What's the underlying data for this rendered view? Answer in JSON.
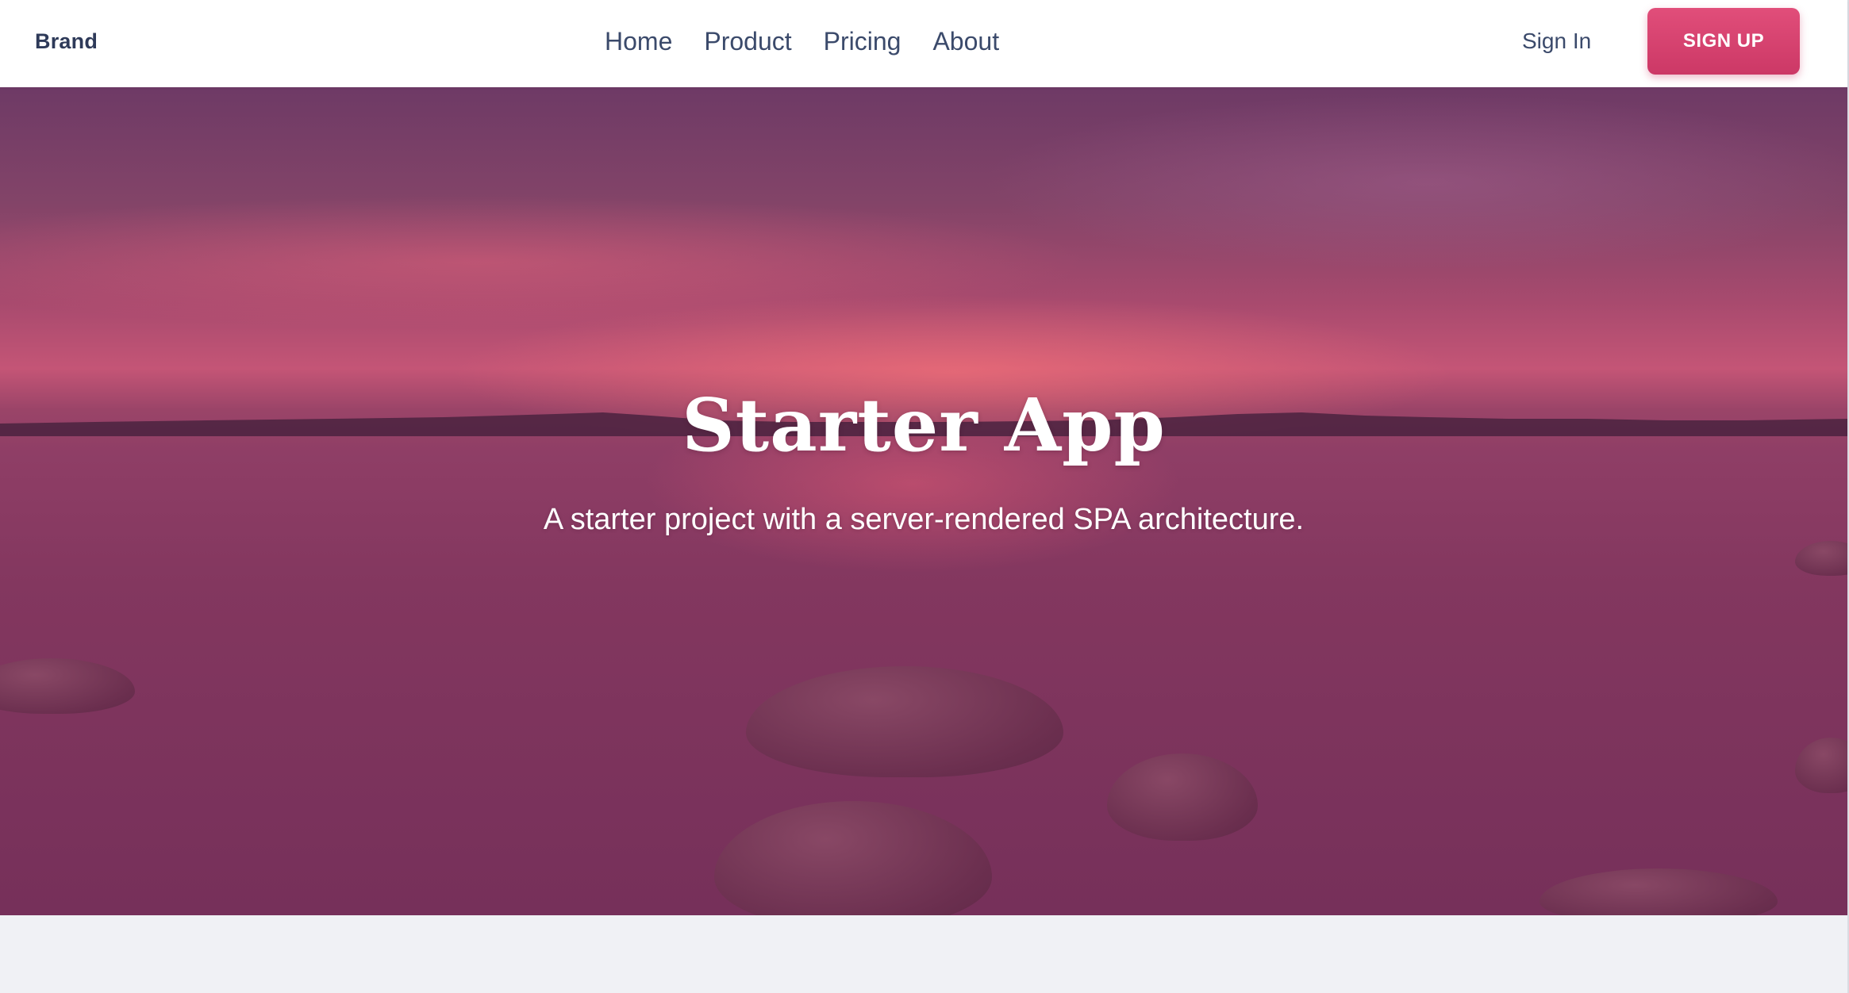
{
  "header": {
    "brand": "Brand",
    "nav": [
      "Home",
      "Product",
      "Pricing",
      "About"
    ],
    "sign_in": "Sign In",
    "sign_up": "SIGN UP"
  },
  "hero": {
    "title": "Starter App",
    "subtitle": "A starter project with a server-rendered SPA architecture."
  },
  "colors": {
    "accent": "#d43f6e",
    "text_dark": "#2e3a59",
    "hero_overlay": "#8a3a64",
    "page_bg": "#f0f1f5"
  }
}
